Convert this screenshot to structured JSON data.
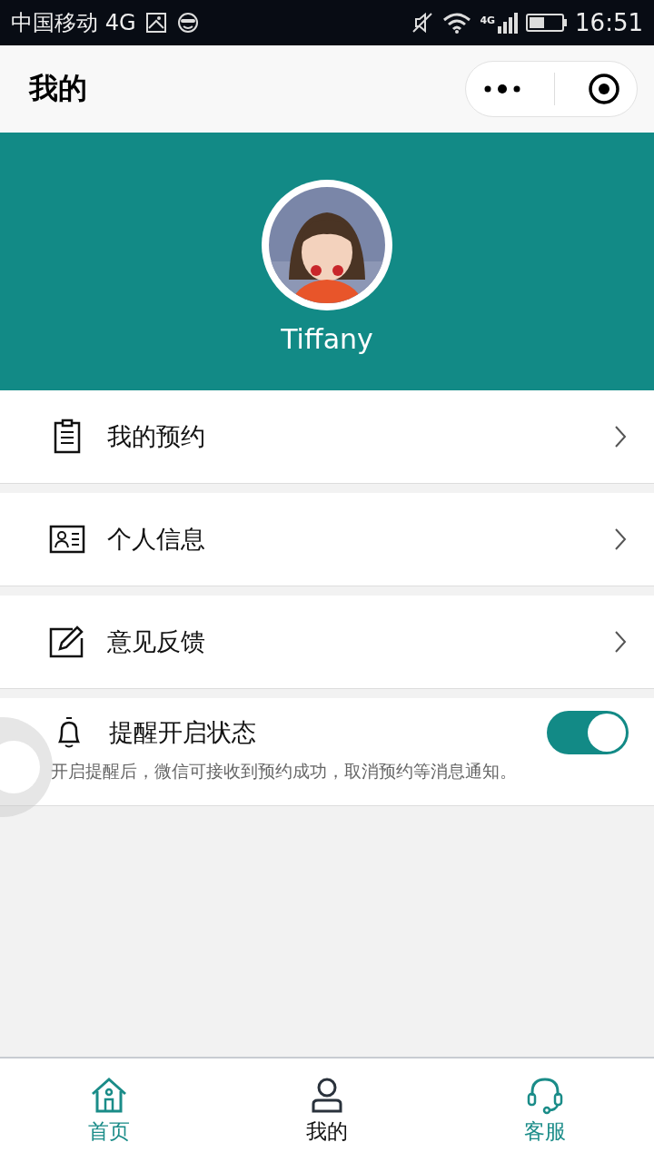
{
  "status_bar": {
    "carrier": "中国移动 4G",
    "network_label": "4G",
    "time": "16:51"
  },
  "header": {
    "title": "我的"
  },
  "profile": {
    "name": "Tiffany"
  },
  "menu": [
    {
      "kind": "link",
      "label": "我的预约"
    },
    {
      "kind": "link",
      "label": "个人信息"
    },
    {
      "kind": "link",
      "label": "意见反馈"
    },
    {
      "kind": "toggle",
      "label": "提醒开启状态",
      "on": true,
      "description": "开启提醒后，微信可接收到预约成功，取消预约等消息通知。"
    }
  ],
  "tabs": [
    {
      "label": "首页",
      "selected": false
    },
    {
      "label": "我的",
      "selected": true
    },
    {
      "label": "客服",
      "selected": false
    }
  ]
}
